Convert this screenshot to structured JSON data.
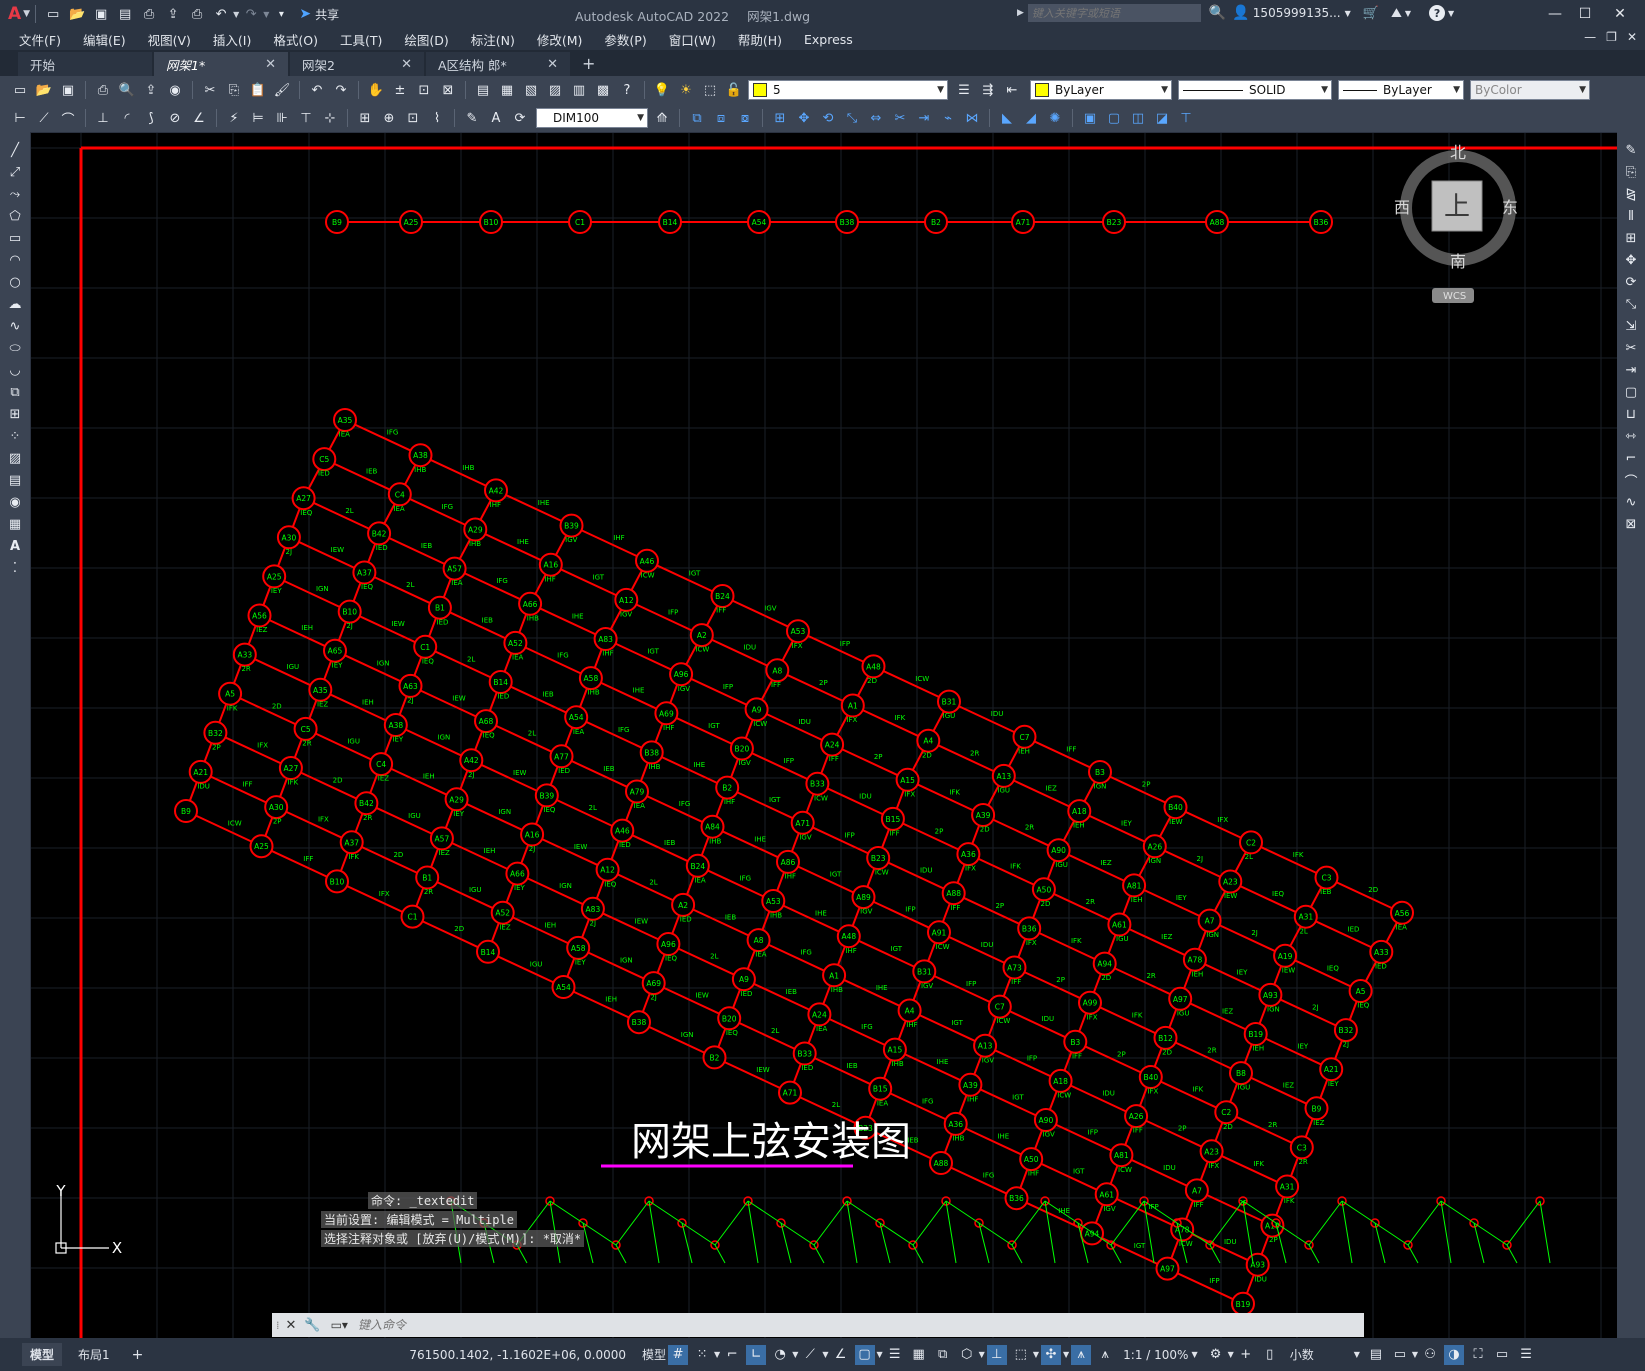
{
  "titlebar": {
    "app_title": "Autodesk AutoCAD 2022",
    "file_name": "网架1.dwg",
    "share_label": "共享",
    "search_placeholder": "键入关键字或短语",
    "user": "1505999135...",
    "window_controls": {
      "minimize": "—",
      "maximize": "☐",
      "close": "✕"
    }
  },
  "menubar": {
    "items": [
      "文件(F)",
      "编辑(E)",
      "视图(V)",
      "插入(I)",
      "格式(O)",
      "工具(T)",
      "绘图(D)",
      "标注(N)",
      "修改(M)",
      "参数(P)",
      "窗口(W)",
      "帮助(H)",
      "Express"
    ]
  },
  "tabs": [
    {
      "label": "开始",
      "active": false,
      "closable": false
    },
    {
      "label": "网架1*",
      "active": true,
      "closable": true
    },
    {
      "label": "网架2",
      "active": false,
      "closable": true
    },
    {
      "label": "A区结构 郎*",
      "active": false,
      "closable": true
    }
  ],
  "toolbar": {
    "layer_value": "5",
    "color_value": "ByLayer",
    "linetype_value": "SOLID",
    "lineweight_value": "ByLayer",
    "plotstyle_value": "ByColor",
    "dimstyle_value": "DIM100"
  },
  "viewcube": {
    "north": "北",
    "south": "南",
    "east": "东",
    "west": "西",
    "top": "上",
    "wcs": "WCS"
  },
  "ucs": {
    "x": "X",
    "y": "Y"
  },
  "drawing": {
    "title": "网架上弦安装图",
    "colors": {
      "member": "#ff0000",
      "text": "#00ff00",
      "underline": "#ff00ff"
    },
    "nodes": [
      "B9",
      "A25",
      "B10",
      "C1",
      "B14",
      "A54",
      "B38",
      "B2",
      "A71",
      "B23",
      "A88",
      "B36",
      "A94",
      "A97",
      "B19",
      "A21",
      "A30",
      "A37",
      "B1",
      "A52",
      "A58",
      "A69",
      "B20",
      "B33",
      "B15",
      "A36",
      "A50",
      "A61",
      "A78",
      "A93",
      "B32",
      "A27",
      "B42",
      "A57",
      "A66",
      "A83",
      "A96",
      "A9",
      "A24",
      "A15",
      "A39",
      "A90",
      "A81",
      "A7",
      "A19",
      "A5",
      "C5",
      "C4",
      "A29",
      "A16",
      "A12",
      "A2",
      "A8",
      "A1",
      "A4",
      "A13",
      "A18",
      "A26",
      "A23",
      "A31",
      "A33",
      "A35",
      "A38",
      "A42",
      "B39",
      "A46",
      "B24",
      "A53",
      "A48",
      "B31",
      "C7",
      "B3",
      "B40",
      "C2",
      "C3",
      "A56",
      "A65",
      "A63",
      "A68",
      "A77",
      "A79",
      "A84",
      "A86",
      "A89",
      "A91",
      "A73",
      "A99",
      "B12",
      "B8"
    ],
    "member_labels": [
      "ICW",
      "IDU",
      "IFF",
      "2P",
      "IFX",
      "IFK",
      "2D",
      "2R",
      "IGU",
      "IEZ",
      "IEH",
      "IEY",
      "IGN",
      "2J",
      "IEW",
      "IEQ",
      "2L",
      "IED",
      "IEB",
      "IEA",
      "IFG",
      "IHB",
      "IHE",
      "IHF",
      "IGT",
      "IGV",
      "IFP"
    ]
  },
  "command": {
    "history": [
      "命令: _textedit",
      "当前设置: 编辑模式 = Multiple",
      "选择注释对象或 [放弃(U)/模式(M)]: *取消*"
    ],
    "placeholder": "键入命令"
  },
  "layout_tabs": [
    "模型",
    "布局1"
  ],
  "status": {
    "coords": "761500.1402, -1.1602E+06, 0.0000",
    "space": "模型",
    "scale": "1:1 / 100%",
    "units": "小数"
  }
}
